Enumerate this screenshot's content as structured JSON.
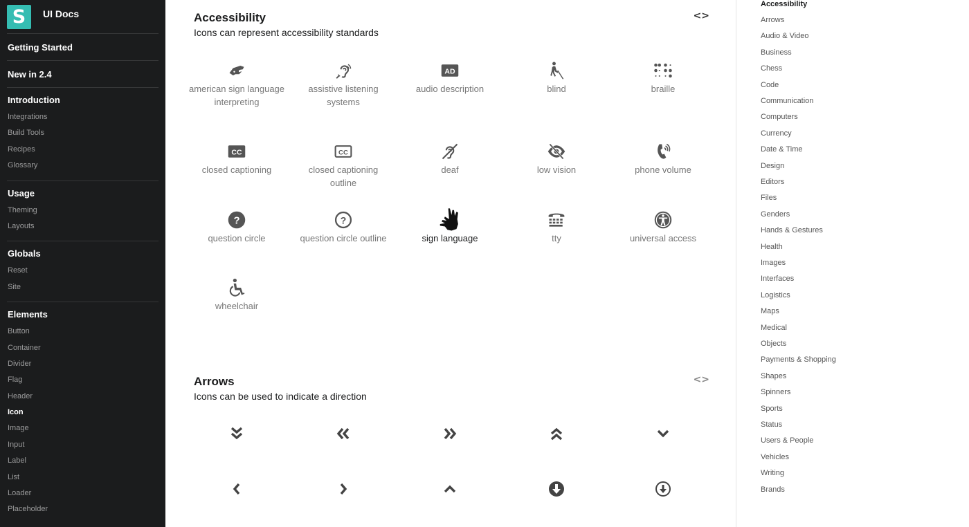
{
  "app": {
    "logo_letter": "S",
    "title": "UI Docs"
  },
  "sidebar": {
    "top_links": [
      "Getting Started",
      "New in 2.4"
    ],
    "groups": [
      {
        "title": "Introduction",
        "items": [
          "Integrations",
          "Build Tools",
          "Recipes",
          "Glossary"
        ]
      },
      {
        "title": "Usage",
        "items": [
          "Theming",
          "Layouts"
        ]
      },
      {
        "title": "Globals",
        "items": [
          "Reset",
          "Site"
        ]
      },
      {
        "title": "Elements",
        "items": [
          "Button",
          "Container",
          "Divider",
          "Flag",
          "Header",
          "Icon",
          "Image",
          "Input",
          "Label",
          "List",
          "Loader",
          "Placeholder"
        ]
      }
    ],
    "active_item": "Icon"
  },
  "sections": {
    "accessibility": {
      "title": "Accessibility",
      "description": "Icons can represent accessibility standards",
      "code_toggle": "<>",
      "icons": [
        {
          "icon": "american-sign-language-interpreting-icon",
          "label": "american sign language interpreting"
        },
        {
          "icon": "assistive-listening-systems-icon",
          "label": "assistive listening systems"
        },
        {
          "icon": "audio-description-icon",
          "label": "audio description"
        },
        {
          "icon": "blind-icon",
          "label": "blind"
        },
        {
          "icon": "braille-icon",
          "label": "braille"
        },
        {
          "icon": "closed-captioning-icon",
          "label": "closed captioning"
        },
        {
          "icon": "closed-captioning-outline-icon",
          "label": "closed captioning outline"
        },
        {
          "icon": "deaf-icon",
          "label": "deaf"
        },
        {
          "icon": "low-vision-icon",
          "label": "low vision"
        },
        {
          "icon": "phone-volume-icon",
          "label": "phone volume"
        },
        {
          "icon": "question-circle-icon",
          "label": "question circle"
        },
        {
          "icon": "question-circle-outline-icon",
          "label": "question circle outline"
        },
        {
          "icon": "sign-language-icon",
          "label": "sign language",
          "active": true
        },
        {
          "icon": "tty-icon",
          "label": "tty"
        },
        {
          "icon": "universal-access-icon",
          "label": "universal access"
        },
        {
          "icon": "wheelchair-icon",
          "label": "wheelchair"
        }
      ]
    },
    "arrows": {
      "title": "Arrows",
      "description": "Icons can be used to indicate a direction",
      "code_toggle": "<>",
      "icons": [
        {
          "icon": "angle-double-down-icon"
        },
        {
          "icon": "angle-double-left-icon"
        },
        {
          "icon": "angle-double-right-icon"
        },
        {
          "icon": "angle-double-up-icon"
        },
        {
          "icon": "angle-down-icon"
        },
        {
          "icon": "angle-left-icon"
        },
        {
          "icon": "angle-right-icon"
        },
        {
          "icon": "angle-up-icon"
        },
        {
          "icon": "arrow-alternate-circle-down-icon"
        },
        {
          "icon": "arrow-alternate-circle-down-outline-icon"
        }
      ]
    }
  },
  "toc": {
    "items": [
      "Accessibility",
      "Arrows",
      "Audio & Video",
      "Business",
      "Chess",
      "Code",
      "Communication",
      "Computers",
      "Currency",
      "Date & Time",
      "Design",
      "Editors",
      "Files",
      "Genders",
      "Hands & Gestures",
      "Health",
      "Images",
      "Interfaces",
      "Logistics",
      "Maps",
      "Medical",
      "Objects",
      "Payments & Shopping",
      "Shapes",
      "Spinners",
      "Sports",
      "Status",
      "Users & People",
      "Vehicles",
      "Writing",
      "Brands"
    ],
    "active_item": "Accessibility"
  },
  "colors": {
    "sidebar_bg": "#1b1c1d",
    "logo_bg": "#35bdb2",
    "icon_color": "#555555",
    "label_color": "#777777"
  }
}
